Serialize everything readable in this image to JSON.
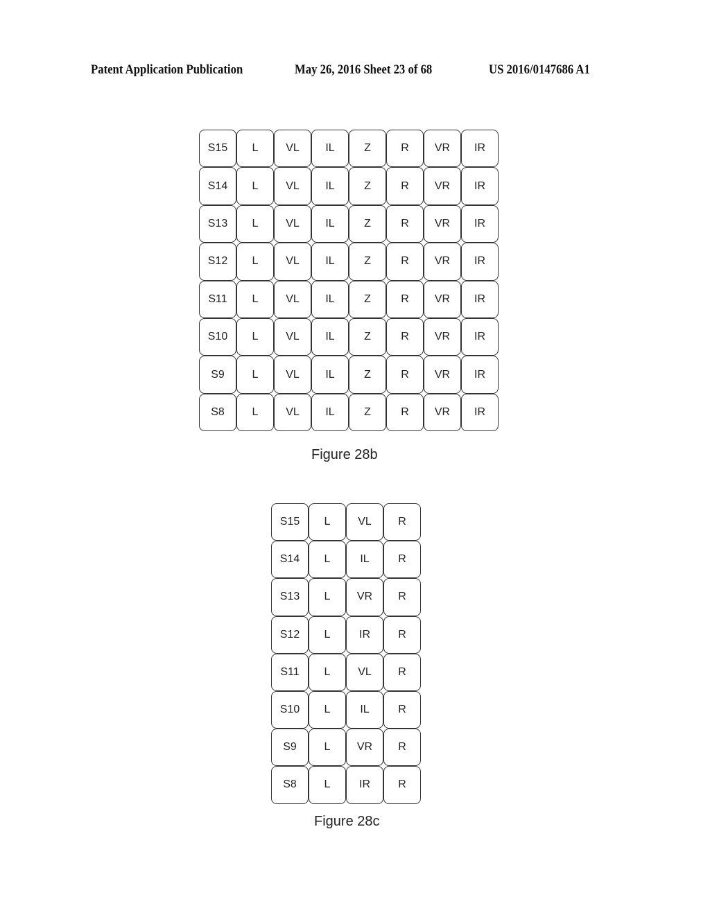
{
  "header": {
    "publication": "Patent Application Publication",
    "date_sheet": "May 26, 2016  Sheet 23 of 68",
    "number": "US 2016/0147686 A1"
  },
  "figures": [
    {
      "caption": "Figure 28b",
      "rows": [
        [
          "S15",
          "L",
          "VL",
          "IL",
          "Z",
          "R",
          "VR",
          "IR"
        ],
        [
          "S14",
          "L",
          "VL",
          "IL",
          "Z",
          "R",
          "VR",
          "IR"
        ],
        [
          "S13",
          "L",
          "VL",
          "IL",
          "Z",
          "R",
          "VR",
          "IR"
        ],
        [
          "S12",
          "L",
          "VL",
          "IL",
          "Z",
          "R",
          "VR",
          "IR"
        ],
        [
          "S11",
          "L",
          "VL",
          "IL",
          "Z",
          "R",
          "VR",
          "IR"
        ],
        [
          "S10",
          "L",
          "VL",
          "IL",
          "Z",
          "R",
          "VR",
          "IR"
        ],
        [
          "S9",
          "L",
          "VL",
          "IL",
          "Z",
          "R",
          "VR",
          "IR"
        ],
        [
          "S8",
          "L",
          "VL",
          "IL",
          "Z",
          "R",
          "VR",
          "IR"
        ]
      ]
    },
    {
      "caption": "Figure 28c",
      "rows": [
        [
          "S15",
          "L",
          "VL",
          "R"
        ],
        [
          "S14",
          "L",
          "IL",
          "R"
        ],
        [
          "S13",
          "L",
          "VR",
          "R"
        ],
        [
          "S12",
          "L",
          "IR",
          "R"
        ],
        [
          "S11",
          "L",
          "VL",
          "R"
        ],
        [
          "S10",
          "L",
          "IL",
          "R"
        ],
        [
          "S9",
          "L",
          "VR",
          "R"
        ],
        [
          "S8",
          "L",
          "IR",
          "R"
        ]
      ]
    }
  ]
}
